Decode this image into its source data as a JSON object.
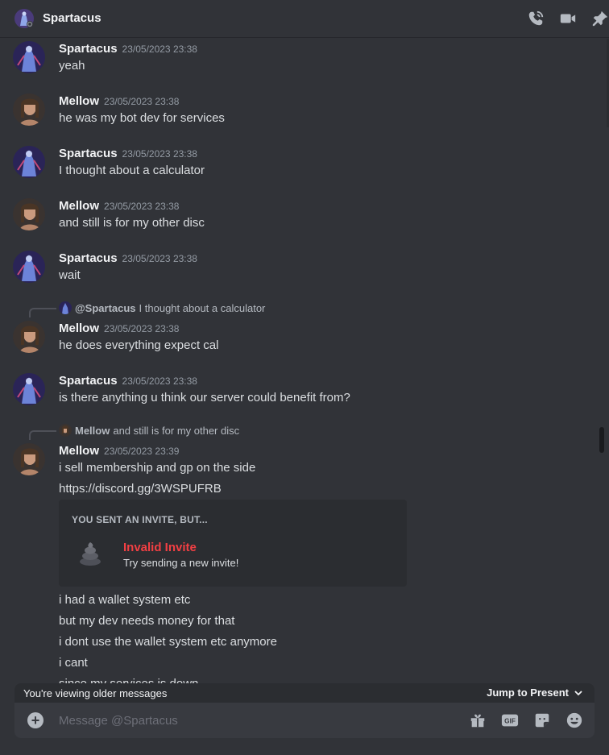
{
  "header": {
    "title": "Spartacus"
  },
  "messages": [
    {
      "author": "Spartacus",
      "time": "23/05/2023 23:38",
      "lines": [
        "yeah"
      ]
    },
    {
      "author": "Mellow",
      "time": "23/05/2023 23:38",
      "lines": [
        "he was my bot dev for services"
      ]
    },
    {
      "author": "Spartacus",
      "time": "23/05/2023 23:38",
      "lines": [
        "I thought about a calculator"
      ]
    },
    {
      "author": "Mellow",
      "time": "23/05/2023 23:38",
      "lines": [
        "and still is for my other disc"
      ]
    },
    {
      "author": "Spartacus",
      "time": "23/05/2023 23:38",
      "lines": [
        "wait"
      ]
    },
    {
      "reply_to": "@Spartacus",
      "reply_text": "I thought about a calculator",
      "author": "Mellow",
      "time": "23/05/2023 23:38",
      "lines": [
        "he does everything expect cal"
      ]
    },
    {
      "author": "Spartacus",
      "time": "23/05/2023 23:38",
      "lines": [
        "is there anything u think our server could benefit from?"
      ]
    },
    {
      "reply_to": "Mellow",
      "reply_text": "and still is for my other disc",
      "author": "Mellow",
      "time": "23/05/2023 23:39",
      "lines": [
        "i sell membership and gp on the side",
        "https://discord.gg/3WSPUFRB"
      ]
    }
  ],
  "invite": {
    "header": "YOU SENT AN INVITE, BUT...",
    "title": "Invalid Invite",
    "subtitle": "Try sending a new invite!"
  },
  "followups": [
    "i had a wallet system etc",
    "but my dev needs money for that",
    "i dont use the wallet system etc anymore",
    "i cant",
    "since my services is down"
  ],
  "older_bar": {
    "label": "You're viewing older messages",
    "jump": "Jump to Present"
  },
  "composer": {
    "placeholder": "Message @Spartacus"
  },
  "colors": {
    "background": "#313338",
    "link": "#00a8fc",
    "error": "#f23f43",
    "composer": "#383a40"
  },
  "icons": [
    "voice-call-icon",
    "video-call-icon",
    "pin-icon",
    "add-attachment-icon",
    "gift-icon",
    "gif-icon",
    "sticker-icon",
    "emoji-icon",
    "chevron-down-icon"
  ]
}
